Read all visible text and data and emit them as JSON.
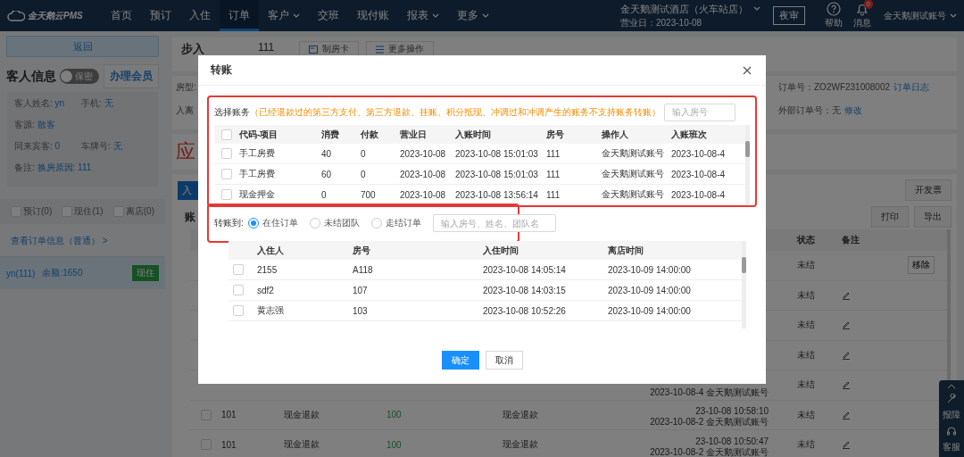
{
  "nav": {
    "logo": "金天鹅云PMS",
    "items": [
      {
        "label": "首页",
        "selected": false,
        "dropdown": false
      },
      {
        "label": "预订",
        "selected": false,
        "dropdown": false
      },
      {
        "label": "入住",
        "selected": false,
        "dropdown": false
      },
      {
        "label": "订单",
        "selected": true,
        "dropdown": false
      },
      {
        "label": "客户",
        "selected": false,
        "dropdown": true
      },
      {
        "label": "交班",
        "selected": false,
        "dropdown": false
      },
      {
        "label": "现付账",
        "selected": false,
        "dropdown": false
      },
      {
        "label": "报表",
        "selected": false,
        "dropdown": true
      },
      {
        "label": "更多",
        "selected": false,
        "dropdown": true
      }
    ],
    "hotel": "金天鹅测试酒店（火车站店）",
    "business_date": "营业日：2023-10-08",
    "night_audit": "夜审",
    "help": "帮助",
    "messages": "消息",
    "message_badge": "0",
    "account": "金天鹅测试账号"
  },
  "sidebar": {
    "back": "返回",
    "guest_title": "客人信息",
    "privacy": {
      "label": "保密",
      "on": false
    },
    "member_button": "办理会员",
    "fields": [
      [
        {
          "label": "客人姓名:",
          "value": "yn"
        },
        {
          "label": "手机:",
          "value": "无"
        }
      ],
      [
        {
          "label": "客源:",
          "value": "散客"
        }
      ],
      [
        {
          "label": "同来宾客:",
          "value": "0"
        },
        {
          "label": "车牌号:",
          "value": "无"
        }
      ],
      [
        {
          "label": "备注:",
          "value": "换房原因: 111"
        }
      ]
    ],
    "filters": [
      {
        "label": "预订(0)",
        "checked": false
      },
      {
        "label": "现住(1)",
        "checked": false
      },
      {
        "label": "离店(0)",
        "checked": false
      }
    ],
    "order_link": "查看订单信息（普通） >",
    "guests": [
      {
        "name": "yn(111)",
        "balance": "余额:1650",
        "status": "现住",
        "selected": true
      }
    ]
  },
  "order": {
    "title": "步入",
    "room": "111",
    "buttons": [
      {
        "label": "制房卡",
        "kind": "card"
      },
      {
        "label": "更多操作",
        "kind": "list"
      }
    ],
    "room_type_label": "房型:",
    "stay_label": "入离",
    "order_no": "订单号：ZO2WF231008002",
    "order_log": "订单日志",
    "external_no": "外部订单号：无",
    "edit": "修改",
    "amount_title": "应"
  },
  "ledger": {
    "add_button": "入",
    "invoice": "开发票",
    "heading": "账",
    "print": "打印",
    "export": "导出",
    "columns": [
      "状态",
      "备注"
    ],
    "rows": [
      {
        "kind": "removable",
        "action": "移除",
        "status": "未结"
      },
      {
        "kind": "editable",
        "status": "未结"
      },
      {
        "kind": "editable",
        "status": "未结"
      },
      {
        "kind": "editable",
        "status": "未结"
      },
      {
        "kind": "editable",
        "status": "未结",
        "posted": [
          "2023-10-08-4 金天鹅测试账号"
        ]
      },
      {
        "kind": "editable",
        "checked": false,
        "room": "101",
        "item": "现金退款",
        "amount": "100",
        "method": "现金退款",
        "posted": [
          "23-10-08 10:58:10",
          "2023-10-08-2 金天鹅测试账号"
        ],
        "status": "未结"
      },
      {
        "kind": "editable",
        "checked": false,
        "room": "101",
        "item": "现金退款",
        "amount": "100",
        "method": "现金退款",
        "posted": [
          "23-10-08 10:50:47",
          "2023-10-08-2 金天鹅测试账号"
        ],
        "status": "未结"
      }
    ]
  },
  "dialog": {
    "title": "转账",
    "source": {
      "highlighted": true,
      "label": "选择账务",
      "note": "（已经退款过的第三方支付、第三方退款、挂账、积分抵现、冲调过和冲调产生的账务不支持账务转账）",
      "placeholder": "输入房号",
      "all_checked": false,
      "columns": [
        "代码-项目",
        "消费",
        "付款",
        "营业日",
        "入账时间",
        "房号",
        "操作人",
        "入账班次"
      ],
      "rows": [
        {
          "checked": false,
          "cells": [
            "手工房费",
            "40",
            "0",
            "2023-10-08",
            "2023-10-08 15:01:03",
            "111",
            "金天鹅测试账号",
            "2023-10-08-4"
          ]
        },
        {
          "checked": false,
          "cells": [
            "手工房费",
            "60",
            "0",
            "2023-10-08",
            "2023-10-08 15:01:03",
            "111",
            "金天鹅测试账号",
            "2023-10-08-4"
          ]
        },
        {
          "checked": false,
          "cells": [
            "现金押金",
            "0",
            "700",
            "2023-10-08",
            "2023-10-08 13:56:14",
            "111",
            "金天鹅测试账号",
            "2023-10-08-4"
          ]
        }
      ]
    },
    "target": {
      "highlighted": true,
      "label": "转账到:",
      "options": [
        {
          "label": "在住订单",
          "selected": true
        },
        {
          "label": "未结团队",
          "selected": false
        },
        {
          "label": "走结订单",
          "selected": false
        }
      ],
      "placeholder": "输入房号、姓名、团队名",
      "columns": [
        "入住人",
        "房号",
        "入住时间",
        "离店时间"
      ],
      "rows": [
        {
          "checked": false,
          "cells": [
            "2155",
            "A118",
            "2023-10-08 14:05:14",
            "2023-10-09 14:00:00"
          ]
        },
        {
          "checked": false,
          "cells": [
            "sdf2",
            "107",
            "2023-10-08 14:03:15",
            "2023-10-09 14:00:00"
          ]
        },
        {
          "checked": false,
          "cells": [
            "黄志强",
            "103",
            "2023-10-08 10:52:26",
            "2023-10-09 14:00:00"
          ]
        }
      ]
    },
    "buttons": [
      {
        "label": "确定",
        "kind": "primary"
      },
      {
        "label": "取消",
        "kind": "default"
      }
    ]
  },
  "float_bar": {
    "report": "报障",
    "service": "客服"
  }
}
